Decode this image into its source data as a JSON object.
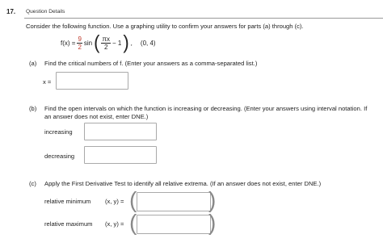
{
  "question": {
    "number": "17.",
    "details_label": "Question Details",
    "prompt": "Consider the following function. Use a graphing utility to confirm your answers for parts (a) through (c).",
    "function": {
      "lhs": "f(x) =",
      "coef_num": "9",
      "coef_den": "2",
      "sin": "sin",
      "arg_num": "πx",
      "arg_den": "2",
      "minus_one": "− 1",
      "interval": "(0, 4)"
    }
  },
  "part_a": {
    "label": "(a)",
    "text": "Find the critical numbers of f. (Enter your answers as a comma-separated list.)",
    "field_label": "x =",
    "value": ""
  },
  "part_b": {
    "label": "(b)",
    "text_line1": "Find the open intervals on which the function is increasing or decreasing. (Enter your answers using interval notation. If",
    "text_line2": "an answer does not exist, enter DNE.)",
    "increasing_label": "increasing",
    "decreasing_label": "decreasing",
    "increasing_value": "",
    "decreasing_value": ""
  },
  "part_c": {
    "label": "(c)",
    "text": "Apply the First Derivative Test to identify all relative extrema. (If an answer does not exist, enter DNE.)",
    "min_label": "relative minimum",
    "max_label": "relative maximum",
    "point_label": "(x, y) =",
    "min_value": "",
    "max_value": ""
  },
  "colors": {
    "accent_red": "#c0392b",
    "border": "#aaaaaa"
  }
}
